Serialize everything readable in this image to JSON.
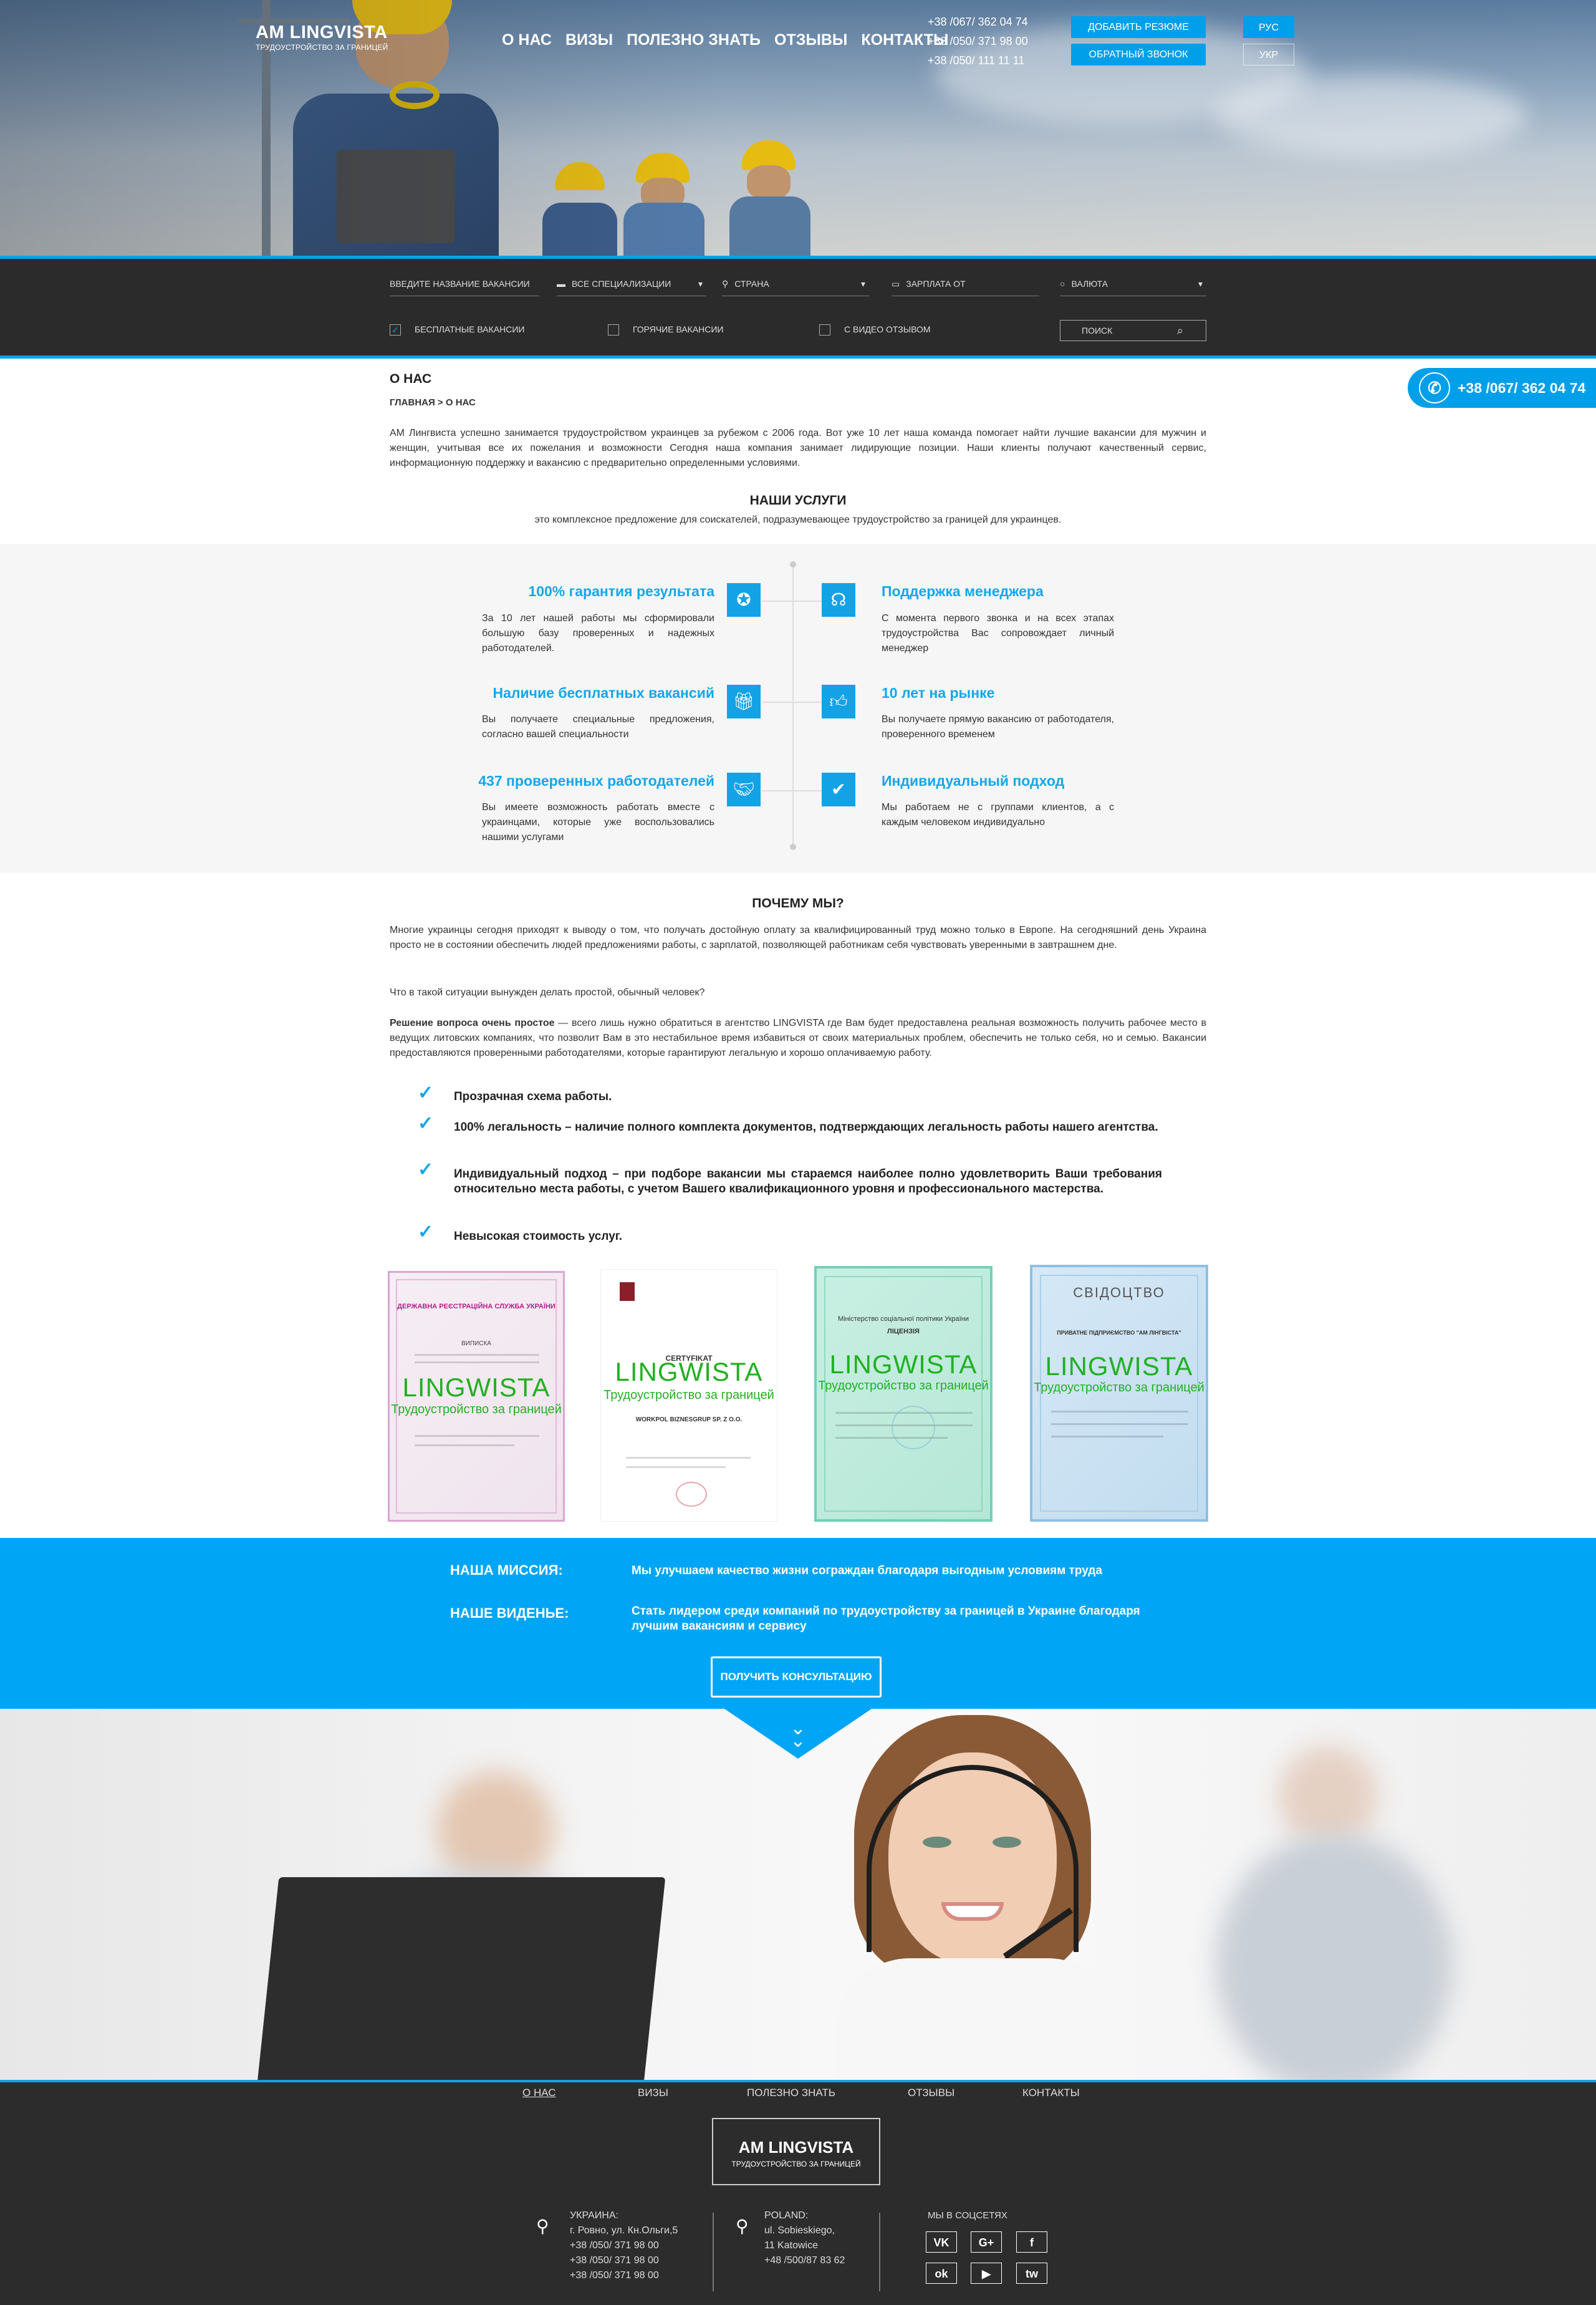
{
  "brand": {
    "title": "AM LINGVISTA",
    "subtitle": "ТРУДОУСТРОЙСТВО ЗА ГРАНИЦЕЙ"
  },
  "nav": [
    "О НАС",
    "ВИЗЫ",
    "ПОЛЕЗНО ЗНАТЬ",
    "ОТЗЫВЫ",
    "КОНТАКТЫ"
  ],
  "phones": [
    "+38 /067/ 362 04 74",
    "+38 /050/ 371 98 00",
    "+38 /050/ 111 11 11"
  ],
  "header_buttons": {
    "add_resume": "ДОБАВИТЬ РЕЗЮМЕ",
    "callback": "ОБРАТНЫЙ ЗВОНОК"
  },
  "languages": [
    "РУС",
    "УКР"
  ],
  "search": {
    "vacancy_placeholder": "ВВЕДИТЕ НАЗВАНИЕ ВАКАНСИИ",
    "specialization": "ВСЕ СПЕЦИАЛИЗАЦИИ",
    "country": "СТРАНА",
    "salary": "ЗАРПЛАТА ОТ",
    "currency": "ВАЛЮТА",
    "filters": [
      "БЕСПЛАТНЫЕ ВАКАНСИИ",
      "ГОРЯЧИЕ ВАКАНСИИ",
      "С ВИДЕО ОТЗЫВОМ"
    ],
    "search_placeholder": "ПОИСК"
  },
  "call_widget": {
    "phone": "+38 /067/ 362 04 74"
  },
  "about": {
    "title": "О НАС",
    "breadcrumb": "ГЛАВНАЯ > О НАС",
    "text": "АМ Лингвиста успешно занимается трудоустройством украинцев за рубежом с 2006 года. Вот уже 10 лет наша команда помогает  найти лучшие вакансии для мужчин и женщин, учитывая все их пожелания и возможности Сегодня наша компания занимает лидирующие позиции. Наши клиенты получают качественный сервис, информационную поддержку и вакансию с предварительно определенными условиями."
  },
  "services": {
    "title": "НАШИ УСЛУГИ",
    "subtitle": "это комплексное предложение для соискателей, подразумевающее трудоустройство за границей для украинцев.",
    "items": [
      {
        "title": "100% гарантия результата",
        "text": "За 10 лет нашей работы мы сформировали большую базу проверенных и надежных работодателей.",
        "icon": "award-icon"
      },
      {
        "title": "Поддержка менеджера",
        "text": "С момента первого звонка и на всех этапах трудоустройства Вас сопровождает личный менеджер",
        "icon": "headset-icon"
      },
      {
        "title": "Наличие бесплатных вакансий",
        "text": "Вы получаете специальные предложения, согласно вашей специальности",
        "icon": "gift-icon"
      },
      {
        "title": "10 лет на рынке",
        "text": "Вы получаете прямую вакансию от работодателя, проверенного временем",
        "icon": "thumbs-up-icon"
      },
      {
        "title": "437 проверенных работодателей",
        "text": "Вы имеете возможность работать вместе с украинцами, которые уже воспользовались нашими услугами",
        "icon": "handshake-icon"
      },
      {
        "title": "Индивидуальный подход",
        "text": "Мы работаем не с группами клиентов, а с каждым человеком индивидуально",
        "icon": "user-check-icon"
      }
    ]
  },
  "why": {
    "title": "ПОЧЕМУ МЫ?",
    "p1": "Многие украинцы сегодня приходят к выводу о том, что получать достойную оплату за квалифицированный труд можно только в Европе. На сегодняшний день Украина просто не в состоянии обеспечить людей предложениями работы, с зарплатой, позволяющей работникам себя чувствовать уверенными в завтрашнем дне.",
    "p2": "Что в такой ситуации вынужден делать простой, обычный человек?",
    "p3_bold": "Решение вопроса очень простое",
    "p3": " — всего лишь нужно обратиться в агентство LINGVISTA где Вам будет предоставлена реальная возможность получить рабочее место в ведущих литовских компаниях, что позволит Вам в это нестабильное время избавиться от своих материальных проблем, обеспечить не только себя, но и семью. Вакансии предоставляются проверенными работодателями, которые гарантируют легальную и хорошо оплачиваемую работу.",
    "list": [
      "Прозрачная схема работы.",
      "100% легальность – наличие полного комплекта документов, подтверждающих легальность работы нашего агентства.",
      "Индивидуальный подход – при подборе вакансии мы стараемся наиболее полно удовлетворить Ваши требования относительно места работы, с учетом Вашего квалификационного уровня и профессионального мастерства.",
      "Невысокая стоимость услуг."
    ]
  },
  "certificates": {
    "watermark": "LINGWISTA",
    "watermark_sub": "Трудоустройство за границей",
    "items": [
      {
        "head": "ДЕРЖАВНА РЕЄСТРАЦІЙНА СЛУЖБА УКРАЇНИ",
        "sub": "ВИПИСКА"
      },
      {
        "head": "CERTYFIKAT",
        "sub": "WORKPOL BIZNESGRUP SP. Z O.O."
      },
      {
        "head": "Міністерство соціальної політики України",
        "sub": "ЛІЦЕНЗІЯ"
      },
      {
        "head": "СВІДОЦТВО",
        "sub": "ПРИВАТНЕ ПІДПРИЄМСТВО \"АМ ЛІНГВІСТА\""
      }
    ]
  },
  "mission": {
    "mission_label": "НАША МИССИЯ:",
    "mission_text": "Мы улучшаем качество жизни сограждан благодаря выгодным условиям труда",
    "vision_label": "НАШЕ ВИДЕНЬЕ:",
    "vision_text": "Стать лидером среди компаний по трудоустройству за границей в Украине благодаря лучшим вакансиям и сервису",
    "button": "ПОЛУЧИТЬ КОНСУЛЬТАЦИЮ"
  },
  "footer": {
    "nav": [
      "О НАС",
      "ВИЗЫ",
      "ПОЛЕЗНО ЗНАТЬ",
      "ОТЗЫВЫ",
      "КОНТАКТЫ"
    ],
    "logo_title": "AM LINGVISTA",
    "logo_sub": "ТРУДОУСТРОЙСТВО ЗА ГРАНИЦЕЙ",
    "ukraine": [
      "УКРАИНА:",
      "г. Ровно, ул. Кн.Ольги,5",
      "+38 /050/ 371 98 00",
      "+38 /050/ 371 98 00",
      "+38 /050/ 371 98 00"
    ],
    "poland": [
      "POLAND:",
      "ul. Sobieskiego,",
      "11 Katowice",
      "+48 /500/87 83 62"
    ],
    "social_title": "МЫ В СОЦСЕТЯХ",
    "social": [
      "VK",
      "G+",
      "f",
      "ok",
      "▶",
      "tw"
    ]
  }
}
